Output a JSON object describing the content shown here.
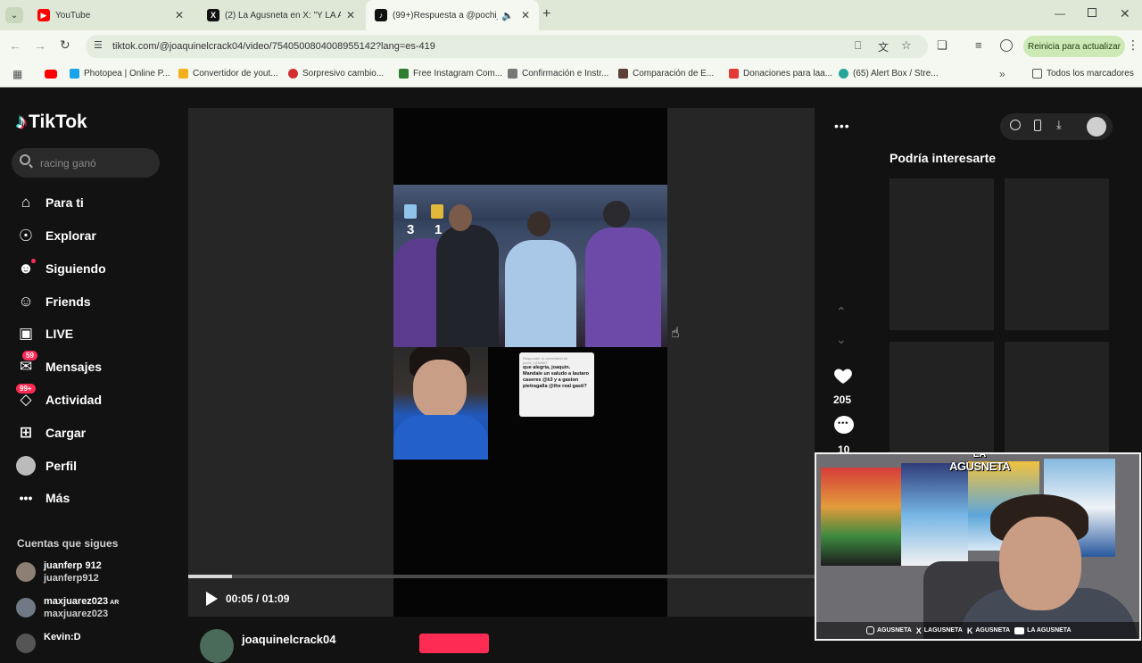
{
  "tabs": [
    {
      "title": "YouTube",
      "icon": "youtube-icon",
      "color": "#ff0000"
    },
    {
      "title": "(2) La Agusneta en X: \"Y LA ACA",
      "icon": "x-icon",
      "color": "#000000"
    },
    {
      "title": "(99+)Respuesta a @pochi_",
      "icon": "tiktok-icon",
      "color": "#000000"
    }
  ],
  "toolbar": {
    "url": "tiktok.com/@joaquinelcrack04/video/7540500804008955142?lang=es-419",
    "update_label": "Reinicia para actualizar"
  },
  "bookmarks": [
    {
      "label": "Photopea | Online P...",
      "color": "#19a3e8"
    },
    {
      "label": "Convertidor de yout...",
      "color": "#f2b01e"
    },
    {
      "label": "Sorpresivo cambio...",
      "color": "#d32f2f"
    },
    {
      "label": "Free Instagram Com...",
      "color": "#2e7d32"
    },
    {
      "label": "Confirmación e Instr...",
      "color": "#777777"
    },
    {
      "label": "Comparación de E...",
      "color": "#5d4037"
    },
    {
      "label": "Donaciones para laa...",
      "color": "#e53935"
    },
    {
      "label": "(65) Alert Box / Stre...",
      "color": "#26a69a"
    }
  ],
  "all_bookmarks": "Todos los marcadores",
  "tiktok": {
    "logo": "TikTok",
    "search_text": "racing ganó",
    "nav": [
      {
        "label": "Para ti",
        "icon": "home-icon"
      },
      {
        "label": "Explorar",
        "icon": "compass-icon"
      },
      {
        "label": "Siguiendo",
        "icon": "following-icon"
      },
      {
        "label": "Friends",
        "icon": "friends-icon"
      },
      {
        "label": "LIVE",
        "icon": "live-icon"
      },
      {
        "label": "Mensajes",
        "icon": "messages-icon",
        "badge": "59"
      },
      {
        "label": "Actividad",
        "icon": "activity-icon",
        "badge": "99+"
      },
      {
        "label": "Cargar",
        "icon": "upload-icon"
      },
      {
        "label": "Perfil",
        "icon": "profile-avatar-icon"
      },
      {
        "label": "Más",
        "icon": "more-icon"
      }
    ],
    "following_header": "Cuentas que sigues",
    "following": [
      {
        "name": "juanferp 912",
        "user": "juanferp912",
        "tag": ""
      },
      {
        "name": "maxjuarez023",
        "user": "maxjuarez023",
        "tag": "AR"
      },
      {
        "name": "Kevin:D",
        "user": "",
        "tag": ""
      }
    ],
    "video": {
      "score_home": "3",
      "score_away": "1",
      "caption_header": "Responder al comentario de pochi_1234567",
      "caption_body": "que alegria, joaquin. Mandale un saludo a lautaro caseres @k3 y a gaston pietragalla @the real gasti?",
      "time": "00:05 / 01:09",
      "progress": 0.07,
      "author": "joaquinelcrack04"
    },
    "likes": "205",
    "comments": "10",
    "sidebar_title": "Podría interesarte"
  },
  "stream": {
    "brand_line1": "LA",
    "brand_line2": "AGUSNETA",
    "socials": [
      {
        "icon": "instagram-icon",
        "label": "AGUSNETA"
      },
      {
        "icon": "x-icon",
        "label": "LAGUSNETA"
      },
      {
        "icon": "kick-icon",
        "label": "AGUSNETA"
      },
      {
        "icon": "youtube-icon",
        "label": "LA AGUSNETA"
      }
    ]
  }
}
